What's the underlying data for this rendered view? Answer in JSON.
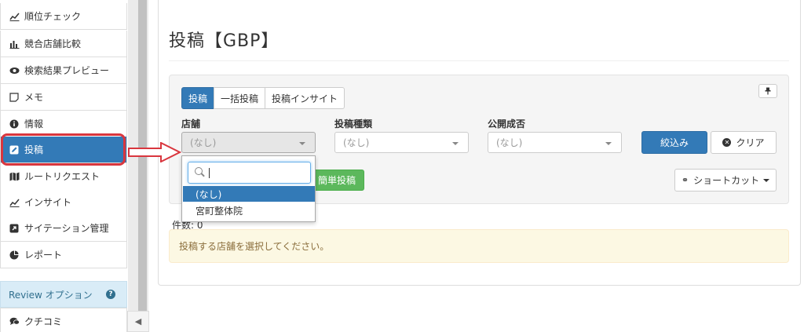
{
  "sidebar": {
    "items": [
      {
        "label": "順位チェック",
        "icon": "line-chart-icon"
      },
      {
        "label": "競合店舗比較",
        "icon": "bar-chart-icon"
      },
      {
        "label": "検索結果プレビュー",
        "icon": "eye-icon"
      },
      {
        "label": "メモ",
        "icon": "memo-icon"
      },
      {
        "label": "情報",
        "icon": "info-icon"
      },
      {
        "label": "投稿",
        "icon": "edit-icon"
      },
      {
        "label": "ルートリクエスト",
        "icon": "map-icon"
      },
      {
        "label": "インサイト",
        "icon": "line-chart-icon"
      },
      {
        "label": "サイテーション管理",
        "icon": "external-link-icon"
      },
      {
        "label": "レポート",
        "icon": "pie-chart-icon"
      }
    ],
    "review_section": {
      "label": "Review オプション",
      "help": "?"
    },
    "review_items": [
      {
        "label": "クチコミ",
        "icon": "comments-icon"
      }
    ],
    "collapse_glyph": "◀"
  },
  "main": {
    "title": "投稿【GBP】",
    "pin_glyph": "📌",
    "tabs": [
      {
        "label": "投稿",
        "active": true
      },
      {
        "label": "一括投稿",
        "active": false
      },
      {
        "label": "投稿インサイト",
        "active": false
      }
    ],
    "filters": {
      "store": {
        "label": "店舗",
        "value": "(なし)"
      },
      "post_type": {
        "label": "投稿種類",
        "value": "(なし)"
      },
      "publish_status": {
        "label": "公開成否",
        "value": "(なし)"
      }
    },
    "buttons": {
      "filter": "絞込み",
      "clear": "クリア",
      "clear_glyph": "✕",
      "easy_post": "簡単投稿",
      "shortcut": "ショートカット",
      "shortcut_glyph": "⚭"
    },
    "count_label": "件数: 0",
    "alert": "投稿する店舗を選択してください。"
  },
  "dropdown": {
    "search_value": "",
    "options": [
      {
        "label": "(なし)",
        "selected": true
      },
      {
        "label": "宮町整体院",
        "selected": false
      }
    ]
  },
  "colors": {
    "primary": "#337ab7",
    "success": "#5cb85c",
    "annotation_red": "#d9363e",
    "warning_bg": "#fcf8e3",
    "review_bg": "#d9ecf7"
  }
}
